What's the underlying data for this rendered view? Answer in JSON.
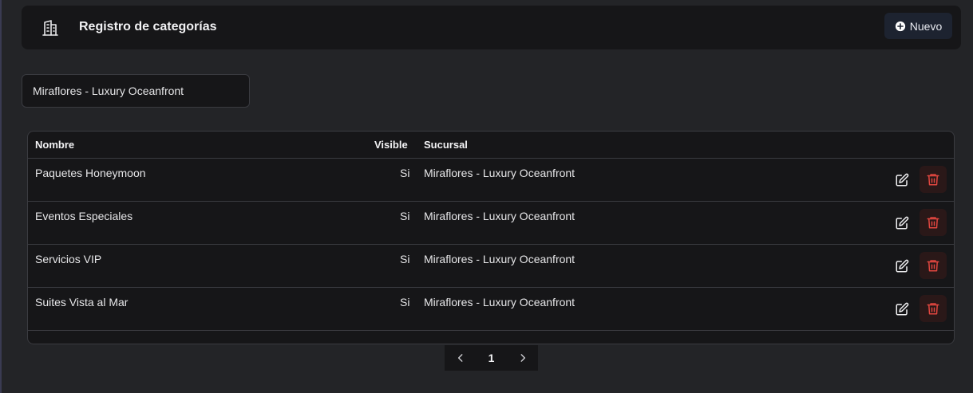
{
  "header": {
    "icon": "building-icon",
    "title": "Registro de categorías",
    "new_button": {
      "label": "Nuevo",
      "icon": "plus-circle-icon"
    }
  },
  "branch_select": {
    "value": "Miraflores - Luxury Oceanfront"
  },
  "table": {
    "columns": [
      "Nombre",
      "Visible",
      "Sucursal"
    ],
    "rows": [
      {
        "nombre": "Paquetes Honeymoon",
        "visible": "Si",
        "sucursal": "Miraflores - Luxury Oceanfront"
      },
      {
        "nombre": "Eventos Especiales",
        "visible": "Si",
        "sucursal": "Miraflores - Luxury Oceanfront"
      },
      {
        "nombre": "Servicios VIP",
        "visible": "Si",
        "sucursal": "Miraflores - Luxury Oceanfront"
      },
      {
        "nombre": "Suites Vista al Mar",
        "visible": "Si",
        "sucursal": "Miraflores - Luxury Oceanfront"
      }
    ],
    "row_actions": {
      "edit_icon": "edit-icon",
      "delete_icon": "trash-icon"
    }
  },
  "pagination": {
    "current_page": "1",
    "prev_icon": "chevron-left-icon",
    "next_icon": "chevron-right-icon"
  },
  "colors": {
    "background": "#232427",
    "panel": "#161618",
    "border": "#3a3b40",
    "delete_accent": "#e0463f",
    "button_bg": "#1d2330"
  }
}
